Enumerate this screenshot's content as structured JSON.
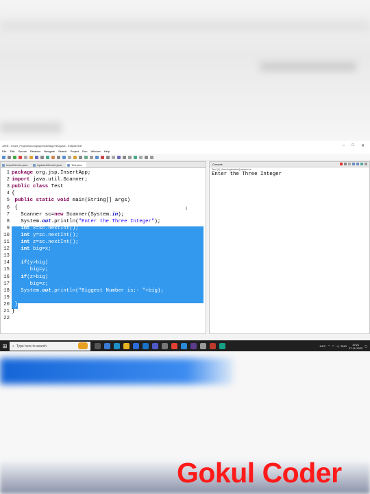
{
  "window": {
    "title": "J2EE - Insert_Project/src/org/jsp/InsertApp/Test.java - Eclipse IDE",
    "controls": [
      "–",
      "□",
      "✕"
    ]
  },
  "menu": [
    "File",
    "Edit",
    "Source",
    "Refactor",
    "Navigate",
    "Search",
    "Project",
    "Run",
    "Window",
    "Help"
  ],
  "editor": {
    "tabs": [
      "InsertServlet.java",
      "UpdatedServlet.java",
      "Test.java"
    ],
    "active_tab": 2,
    "lines": [
      {
        "n": "1",
        "html": "<span class='kw'>package</span> org.jsp.InsertApp;"
      },
      {
        "n": "2",
        "html": "<span class='kw'>import</span> java.util.Scanner;"
      },
      {
        "n": "3",
        "html": "<span class='kw'>public class</span> Test"
      },
      {
        "n": "4",
        "html": "{"
      },
      {
        "n": "5",
        "html": " <span class='kw'>public static void</span> main(String[] args)"
      },
      {
        "n": "6",
        "html": " {"
      },
      {
        "n": "7",
        "html": "   Scanner sc=<span class='kw'>new</span> Scanner(System.<span class='fld'>in</span>);"
      },
      {
        "n": "8",
        "html": "   System.<span class='fld'>out</span>.println(<span class='str'>\"Enter the Three Integer\"</span>);"
      },
      {
        "n": "9",
        "html": "   <span class='kw'>int</span> x=sc.nextInt();"
      },
      {
        "n": "10",
        "html": "   <span class='kw'>int</span> y=sc.nextInt();"
      },
      {
        "n": "11",
        "html": "   <span class='kw'>int</span> z=sc.nextInt();"
      },
      {
        "n": "12",
        "html": "   <span class='kw'>int</span> big=x;"
      },
      {
        "n": "13",
        "html": ""
      },
      {
        "n": "14",
        "html": "   <span class='kw'>if</span>(y>big)"
      },
      {
        "n": "15",
        "html": "      big=y;"
      },
      {
        "n": "16",
        "html": "   <span class='kw'>if</span>(z>big)"
      },
      {
        "n": "17",
        "html": "      big=z;"
      },
      {
        "n": "18",
        "html": "   System.<span class='fld'>out</span>.println(<span class='str'>\"Biggest Number is:- \"</span>+big);"
      },
      {
        "n": "19",
        "html": ""
      },
      {
        "n": "20",
        "html": " }"
      },
      {
        "n": "21",
        "html": "}"
      },
      {
        "n": "22",
        "html": ""
      }
    ],
    "selected_lines": [
      9,
      10,
      11,
      12,
      13,
      14,
      15,
      16,
      17,
      18,
      19,
      20
    ]
  },
  "console": {
    "tab_label": "Console",
    "sub_label": "Test (1) [Java Application] javaw.exe",
    "output": "Enter the Three Integer"
  },
  "taskbar": {
    "search_placeholder": "Type here to search",
    "weather": "24°C",
    "lang": "ENG",
    "time": "19:21",
    "date": "27-11-2022"
  },
  "watermark": "Gokul Coder"
}
